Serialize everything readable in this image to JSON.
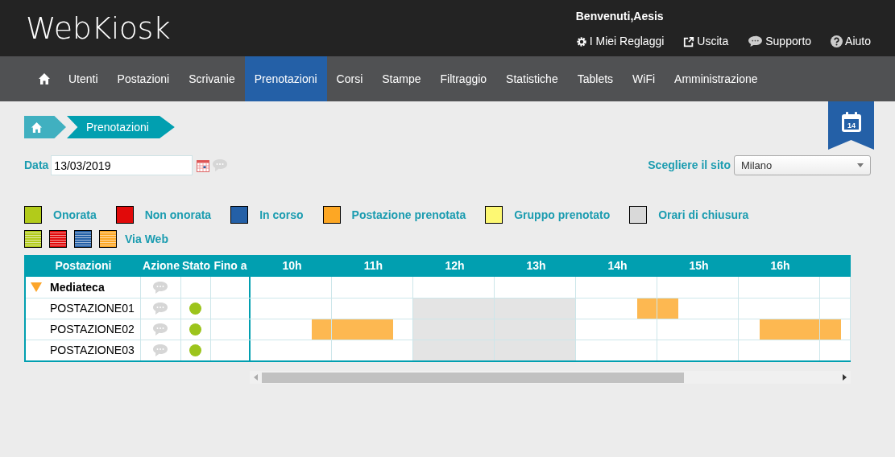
{
  "header": {
    "logo": "WebKiosk",
    "welcome": "Benvenuti,Aesis",
    "links": [
      {
        "kind": "gear",
        "label": "I Miei Reglaggi"
      },
      {
        "kind": "exit",
        "label": "Uscita"
      },
      {
        "kind": "chat",
        "label": "Supporto"
      },
      {
        "kind": "help",
        "label": "Aiuto"
      }
    ]
  },
  "nav": [
    {
      "label": "Utenti",
      "selected": false
    },
    {
      "label": "Postazioni",
      "selected": false
    },
    {
      "label": "Scrivanie",
      "selected": false
    },
    {
      "label": "Prenotazioni",
      "selected": true
    },
    {
      "label": "Corsi",
      "selected": false
    },
    {
      "label": "Stampe",
      "selected": false
    },
    {
      "label": "Filtraggio",
      "selected": false
    },
    {
      "label": "Statistiche",
      "selected": false
    },
    {
      "label": "Tablets",
      "selected": false
    },
    {
      "label": "WiFi",
      "selected": false
    },
    {
      "label": "Amministrazione",
      "selected": false
    }
  ],
  "breadcrumb": "Prenotazioni",
  "calendar_badge": "14",
  "date": {
    "label": "Data",
    "value": "13/03/2019"
  },
  "site": {
    "label": "Scegliere il sito",
    "value": "Milano"
  },
  "legend": [
    {
      "label": "Onorata",
      "color": "#b2cb1a"
    },
    {
      "label": "Non onorata",
      "color": "#e10a0a"
    },
    {
      "label": "In corso",
      "color": "#2460a7"
    },
    {
      "label": "Postazione prenotata",
      "color": "#fda724"
    },
    {
      "label": "Gruppo prenotato",
      "color": "#fdf873"
    },
    {
      "label": "Orari di chiusura",
      "color": "#d9d9d9"
    }
  ],
  "web_legend": {
    "label": "Via Web",
    "swatches": [
      {
        "color": "#b2cb1a"
      },
      {
        "color": "#e10a0a"
      },
      {
        "color": "#2460a7"
      },
      {
        "color": "#fda724"
      }
    ]
  },
  "table": {
    "columns": [
      "Postazioni",
      "Azione",
      "Stato",
      "Fino a"
    ],
    "hours": [
      "10h",
      "11h",
      "12h",
      "13h",
      "14h",
      "15h",
      "16h"
    ],
    "rows": [
      {
        "kind": "group",
        "name": "Mediateca",
        "expanded": true,
        "quarters": [
          {
            "kind": "free"
          },
          {
            "kind": "free"
          },
          {
            "kind": "free"
          },
          {
            "kind": "free"
          },
          {
            "kind": "free"
          },
          {
            "kind": "free"
          },
          {
            "kind": "free"
          },
          {
            "kind": "free"
          },
          {
            "kind": "free"
          },
          {
            "kind": "free"
          },
          {
            "kind": "free"
          },
          {
            "kind": "free"
          },
          {
            "kind": "free"
          },
          {
            "kind": "free"
          },
          {
            "kind": "free"
          },
          {
            "kind": "free"
          },
          {
            "kind": "free"
          },
          {
            "kind": "free"
          },
          {
            "kind": "free"
          },
          {
            "kind": "free"
          },
          {
            "kind": "free"
          },
          {
            "kind": "free"
          },
          {
            "kind": "free"
          },
          {
            "kind": "free"
          },
          {
            "kind": "free"
          },
          {
            "kind": "free"
          },
          {
            "kind": "free"
          },
          {
            "kind": "free"
          },
          {
            "kind": "free"
          },
          {
            "kind": "free"
          }
        ]
      },
      {
        "kind": "station",
        "name": "POSTAZIONE01",
        "color": "#9cc41c",
        "quarters": [
          {
            "kind": "free"
          },
          {
            "kind": "free"
          },
          {
            "kind": "free"
          },
          {
            "kind": "free"
          },
          {
            "kind": "free"
          },
          {
            "kind": "free"
          },
          {
            "kind": "free"
          },
          {
            "kind": "free"
          },
          {
            "kind": "closed"
          },
          {
            "kind": "closed"
          },
          {
            "kind": "closed"
          },
          {
            "kind": "closed"
          },
          {
            "kind": "closed"
          },
          {
            "kind": "closed"
          },
          {
            "kind": "closed"
          },
          {
            "kind": "closed"
          },
          {
            "kind": "free"
          },
          {
            "kind": "free"
          },
          {
            "kind": "free"
          },
          {
            "kind": "booked"
          },
          {
            "kind": "booked"
          },
          {
            "kind": "free"
          },
          {
            "kind": "free"
          },
          {
            "kind": "free"
          },
          {
            "kind": "free"
          },
          {
            "kind": "free"
          },
          {
            "kind": "free"
          },
          {
            "kind": "free"
          },
          {
            "kind": "free"
          },
          {
            "kind": "free"
          }
        ]
      },
      {
        "kind": "station",
        "name": "POSTAZIONE02",
        "color": "#9cc41c",
        "quarters": [
          {
            "kind": "free"
          },
          {
            "kind": "free"
          },
          {
            "kind": "free"
          },
          {
            "kind": "booked"
          },
          {
            "kind": "booked"
          },
          {
            "kind": "booked"
          },
          {
            "kind": "booked"
          },
          {
            "kind": "free"
          },
          {
            "kind": "closed"
          },
          {
            "kind": "closed"
          },
          {
            "kind": "closed"
          },
          {
            "kind": "closed"
          },
          {
            "kind": "closed"
          },
          {
            "kind": "closed"
          },
          {
            "kind": "closed"
          },
          {
            "kind": "closed"
          },
          {
            "kind": "free"
          },
          {
            "kind": "free"
          },
          {
            "kind": "free"
          },
          {
            "kind": "free"
          },
          {
            "kind": "free"
          },
          {
            "kind": "free"
          },
          {
            "kind": "free"
          },
          {
            "kind": "free"
          },
          {
            "kind": "free"
          },
          {
            "kind": "booked"
          },
          {
            "kind": "booked"
          },
          {
            "kind": "booked"
          },
          {
            "kind": "booked"
          },
          {
            "kind": "free"
          }
        ]
      },
      {
        "kind": "station",
        "name": "POSTAZIONE03",
        "color": "#9cc41c",
        "quarters": [
          {
            "kind": "free"
          },
          {
            "kind": "free"
          },
          {
            "kind": "free"
          },
          {
            "kind": "free"
          },
          {
            "kind": "free"
          },
          {
            "kind": "free"
          },
          {
            "kind": "free"
          },
          {
            "kind": "free"
          },
          {
            "kind": "closed"
          },
          {
            "kind": "closed"
          },
          {
            "kind": "closed"
          },
          {
            "kind": "closed"
          },
          {
            "kind": "closed"
          },
          {
            "kind": "closed"
          },
          {
            "kind": "closed"
          },
          {
            "kind": "closed"
          },
          {
            "kind": "free"
          },
          {
            "kind": "free"
          },
          {
            "kind": "free"
          },
          {
            "kind": "free"
          },
          {
            "kind": "free"
          },
          {
            "kind": "free"
          },
          {
            "kind": "free"
          },
          {
            "kind": "free"
          },
          {
            "kind": "free"
          },
          {
            "kind": "free"
          },
          {
            "kind": "free"
          },
          {
            "kind": "free"
          },
          {
            "kind": "free"
          },
          {
            "kind": "free"
          }
        ]
      }
    ]
  }
}
